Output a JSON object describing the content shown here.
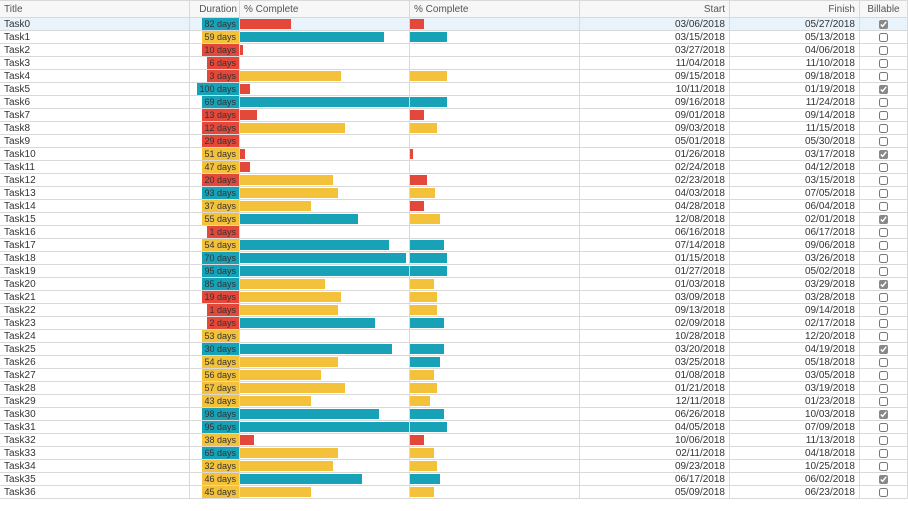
{
  "columns": {
    "title": "Title",
    "duration": "Duration",
    "pc1": "% Complete",
    "pc2": "% Complete",
    "start": "Start",
    "finish": "Finish",
    "billable": "Billable"
  },
  "colors": {
    "teal": "#17a2b8",
    "yellow": "#f3c13a",
    "red": "#e4483a"
  },
  "rows": [
    {
      "title": "Task0",
      "duration": "82 days",
      "dcolor": "teal",
      "pc1": 30,
      "c1": "red",
      "pc2": 8,
      "c2": "red",
      "start": "03/06/2018",
      "finish": "05/27/2018",
      "billable": true,
      "selected": true
    },
    {
      "title": "Task1",
      "duration": "59 days",
      "dcolor": "yellow",
      "pc1": 85,
      "c1": "teal",
      "pc2": 22,
      "c2": "teal",
      "start": "03/15/2018",
      "finish": "05/13/2018",
      "billable": false
    },
    {
      "title": "Task2",
      "duration": "10 days",
      "dcolor": "red",
      "pc1": 2,
      "c1": "red",
      "pc2": 0,
      "c2": "red",
      "start": "03/27/2018",
      "finish": "04/06/2018",
      "billable": false
    },
    {
      "title": "Task3",
      "duration": "6 days",
      "dcolor": "red",
      "pc1": 0,
      "c1": "red",
      "pc2": 0,
      "c2": "red",
      "start": "11/04/2018",
      "finish": "11/10/2018",
      "billable": false
    },
    {
      "title": "Task4",
      "duration": "3 days",
      "dcolor": "red",
      "pc1": 60,
      "c1": "yellow",
      "pc2": 22,
      "c2": "yellow",
      "start": "09/15/2018",
      "finish": "09/18/2018",
      "billable": false
    },
    {
      "title": "Task5",
      "duration": "100 days",
      "dcolor": "teal",
      "pc1": 6,
      "c1": "red",
      "pc2": 0,
      "c2": "red",
      "start": "10/11/2018",
      "finish": "01/19/2018",
      "billable": true
    },
    {
      "title": "Task6",
      "duration": "69 days",
      "dcolor": "teal",
      "pc1": 100,
      "c1": "teal",
      "pc2": 22,
      "c2": "teal",
      "start": "09/16/2018",
      "finish": "11/24/2018",
      "billable": false
    },
    {
      "title": "Task7",
      "duration": "13 days",
      "dcolor": "red",
      "pc1": 10,
      "c1": "red",
      "pc2": 8,
      "c2": "red",
      "start": "09/01/2018",
      "finish": "09/14/2018",
      "billable": false
    },
    {
      "title": "Task8",
      "duration": "12 days",
      "dcolor": "red",
      "pc1": 62,
      "c1": "yellow",
      "pc2": 16,
      "c2": "yellow",
      "start": "09/03/2018",
      "finish": "11/15/2018",
      "billable": false
    },
    {
      "title": "Task9",
      "duration": "29 days",
      "dcolor": "red",
      "pc1": 0,
      "c1": "red",
      "pc2": 0,
      "c2": "red",
      "start": "05/01/2018",
      "finish": "05/30/2018",
      "billable": false
    },
    {
      "title": "Task10",
      "duration": "51 days",
      "dcolor": "yellow",
      "pc1": 3,
      "c1": "red",
      "pc2": 2,
      "c2": "red",
      "start": "01/26/2018",
      "finish": "03/17/2018",
      "billable": true
    },
    {
      "title": "Task11",
      "duration": "47 days",
      "dcolor": "yellow",
      "pc1": 6,
      "c1": "red",
      "pc2": 0,
      "c2": "red",
      "start": "02/24/2018",
      "finish": "04/12/2018",
      "billable": false
    },
    {
      "title": "Task12",
      "duration": "20 days",
      "dcolor": "red",
      "pc1": 55,
      "c1": "yellow",
      "pc2": 10,
      "c2": "red",
      "start": "02/23/2018",
      "finish": "03/15/2018",
      "billable": false
    },
    {
      "title": "Task13",
      "duration": "93 days",
      "dcolor": "teal",
      "pc1": 58,
      "c1": "yellow",
      "pc2": 15,
      "c2": "yellow",
      "start": "04/03/2018",
      "finish": "07/05/2018",
      "billable": false
    },
    {
      "title": "Task14",
      "duration": "37 days",
      "dcolor": "yellow",
      "pc1": 42,
      "c1": "yellow",
      "pc2": 8,
      "c2": "red",
      "start": "04/28/2018",
      "finish": "06/04/2018",
      "billable": false
    },
    {
      "title": "Task15",
      "duration": "55 days",
      "dcolor": "yellow",
      "pc1": 70,
      "c1": "teal",
      "pc2": 18,
      "c2": "yellow",
      "start": "12/08/2018",
      "finish": "02/01/2018",
      "billable": true
    },
    {
      "title": "Task16",
      "duration": "1 days",
      "dcolor": "red",
      "pc1": 0,
      "c1": "red",
      "pc2": 0,
      "c2": "red",
      "start": "06/16/2018",
      "finish": "06/17/2018",
      "billable": false
    },
    {
      "title": "Task17",
      "duration": "54 days",
      "dcolor": "yellow",
      "pc1": 88,
      "c1": "teal",
      "pc2": 20,
      "c2": "teal",
      "start": "07/14/2018",
      "finish": "09/06/2018",
      "billable": false
    },
    {
      "title": "Task18",
      "duration": "70 days",
      "dcolor": "teal",
      "pc1": 98,
      "c1": "teal",
      "pc2": 22,
      "c2": "teal",
      "start": "01/15/2018",
      "finish": "03/26/2018",
      "billable": false
    },
    {
      "title": "Task19",
      "duration": "95 days",
      "dcolor": "teal",
      "pc1": 100,
      "c1": "teal",
      "pc2": 22,
      "c2": "teal",
      "start": "01/27/2018",
      "finish": "05/02/2018",
      "billable": false
    },
    {
      "title": "Task20",
      "duration": "85 days",
      "dcolor": "teal",
      "pc1": 50,
      "c1": "yellow",
      "pc2": 14,
      "c2": "yellow",
      "start": "01/03/2018",
      "finish": "03/29/2018",
      "billable": true
    },
    {
      "title": "Task21",
      "duration": "19 days",
      "dcolor": "red",
      "pc1": 60,
      "c1": "yellow",
      "pc2": 16,
      "c2": "yellow",
      "start": "03/09/2018",
      "finish": "03/28/2018",
      "billable": false
    },
    {
      "title": "Task22",
      "duration": "1 days",
      "dcolor": "red",
      "pc1": 58,
      "c1": "yellow",
      "pc2": 16,
      "c2": "yellow",
      "start": "09/13/2018",
      "finish": "09/14/2018",
      "billable": false
    },
    {
      "title": "Task23",
      "duration": "2 days",
      "dcolor": "red",
      "pc1": 80,
      "c1": "teal",
      "pc2": 20,
      "c2": "teal",
      "start": "02/09/2018",
      "finish": "02/17/2018",
      "billable": false
    },
    {
      "title": "Task24",
      "duration": "53 days",
      "dcolor": "yellow",
      "pc1": 0,
      "c1": "red",
      "pc2": 0,
      "c2": "red",
      "start": "10/28/2018",
      "finish": "12/20/2018",
      "billable": false
    },
    {
      "title": "Task25",
      "duration": "30 days",
      "dcolor": "teal",
      "pc1": 90,
      "c1": "teal",
      "pc2": 20,
      "c2": "teal",
      "start": "03/20/2018",
      "finish": "04/19/2018",
      "billable": true
    },
    {
      "title": "Task26",
      "duration": "54 days",
      "dcolor": "yellow",
      "pc1": 58,
      "c1": "yellow",
      "pc2": 18,
      "c2": "teal",
      "start": "03/25/2018",
      "finish": "05/18/2018",
      "billable": false
    },
    {
      "title": "Task27",
      "duration": "56 days",
      "dcolor": "yellow",
      "pc1": 48,
      "c1": "yellow",
      "pc2": 14,
      "c2": "yellow",
      "start": "01/08/2018",
      "finish": "03/05/2018",
      "billable": false
    },
    {
      "title": "Task28",
      "duration": "57 days",
      "dcolor": "yellow",
      "pc1": 62,
      "c1": "yellow",
      "pc2": 16,
      "c2": "yellow",
      "start": "01/21/2018",
      "finish": "03/19/2018",
      "billable": false
    },
    {
      "title": "Task29",
      "duration": "43 days",
      "dcolor": "yellow",
      "pc1": 42,
      "c1": "yellow",
      "pc2": 12,
      "c2": "yellow",
      "start": "12/11/2018",
      "finish": "01/23/2018",
      "billable": false
    },
    {
      "title": "Task30",
      "duration": "98 days",
      "dcolor": "teal",
      "pc1": 82,
      "c1": "teal",
      "pc2": 20,
      "c2": "teal",
      "start": "06/26/2018",
      "finish": "10/03/2018",
      "billable": true
    },
    {
      "title": "Task31",
      "duration": "95 days",
      "dcolor": "teal",
      "pc1": 100,
      "c1": "teal",
      "pc2": 22,
      "c2": "teal",
      "start": "04/05/2018",
      "finish": "07/09/2018",
      "billable": false
    },
    {
      "title": "Task32",
      "duration": "38 days",
      "dcolor": "yellow",
      "pc1": 8,
      "c1": "red",
      "pc2": 8,
      "c2": "red",
      "start": "10/06/2018",
      "finish": "11/13/2018",
      "billable": false
    },
    {
      "title": "Task33",
      "duration": "65 days",
      "dcolor": "teal",
      "pc1": 58,
      "c1": "yellow",
      "pc2": 14,
      "c2": "yellow",
      "start": "02/11/2018",
      "finish": "04/18/2018",
      "billable": false
    },
    {
      "title": "Task34",
      "duration": "32 days",
      "dcolor": "yellow",
      "pc1": 55,
      "c1": "yellow",
      "pc2": 16,
      "c2": "yellow",
      "start": "09/23/2018",
      "finish": "10/25/2018",
      "billable": false
    },
    {
      "title": "Task35",
      "duration": "46 days",
      "dcolor": "yellow",
      "pc1": 72,
      "c1": "teal",
      "pc2": 18,
      "c2": "teal",
      "start": "06/17/2018",
      "finish": "06/02/2018",
      "billable": true
    },
    {
      "title": "Task36",
      "duration": "45 days",
      "dcolor": "yellow",
      "pc1": 42,
      "c1": "yellow",
      "pc2": 14,
      "c2": "yellow",
      "start": "05/09/2018",
      "finish": "06/23/2018",
      "billable": false
    }
  ]
}
